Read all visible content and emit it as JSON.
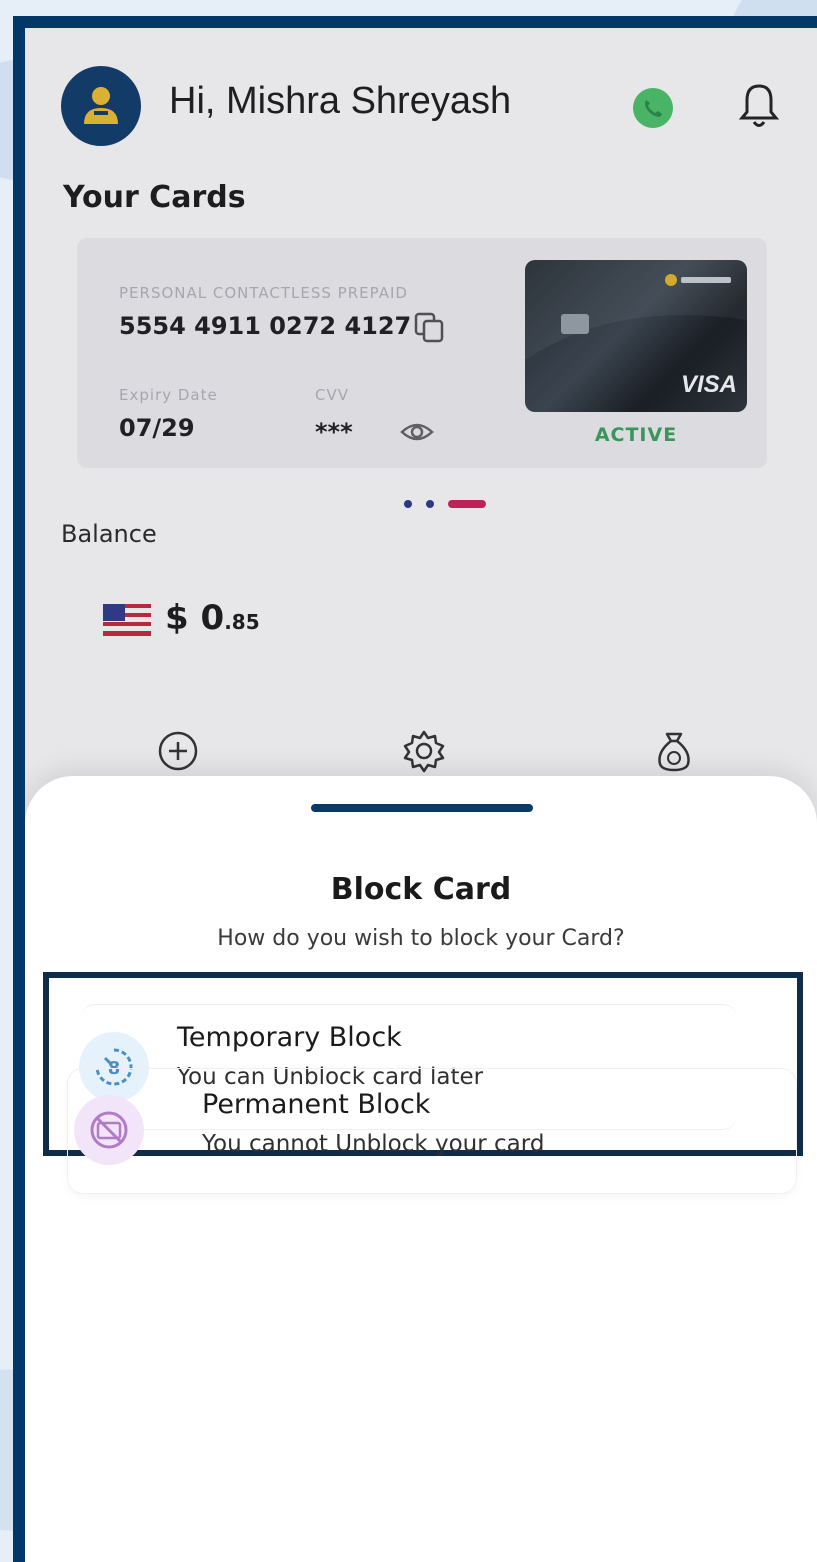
{
  "header": {
    "greeting": "Hi, Mishra Shreyash",
    "whatsapp_icon": "whatsapp-icon",
    "bell_icon": "bell-icon"
  },
  "cards_section": {
    "title": "Your Cards",
    "card": {
      "number_label": "PERSONAL CONTACTLESS PREPAID",
      "number": "5554 4911 0272 4127",
      "expiry_label": "Expiry Date",
      "expiry": "07/29",
      "cvv_label": "CVV",
      "cvv": "***",
      "network": "VISA",
      "status": "ACTIVE",
      "status_color": "#3aa35c"
    }
  },
  "balance": {
    "label": "Balance",
    "currency_symbol": "$",
    "amount_whole": "0",
    "amount_cents": ".85"
  },
  "block_sheet": {
    "title": "Block Card",
    "subtitle": "How do you wish to block your Card?",
    "options": [
      {
        "title": "Temporary Block",
        "description": "You can Unblock card later",
        "icon": "temporary-block-icon",
        "icon_bg": "#e6f2fb"
      },
      {
        "title": "Permanent Block",
        "description": "You cannot Unblock your card",
        "icon": "permanent-block-icon",
        "icon_bg": "#f3e5f9"
      }
    ]
  },
  "colors": {
    "frame": "#013868",
    "highlight_border": "#0f2d48",
    "handle": "#0b3a66"
  }
}
